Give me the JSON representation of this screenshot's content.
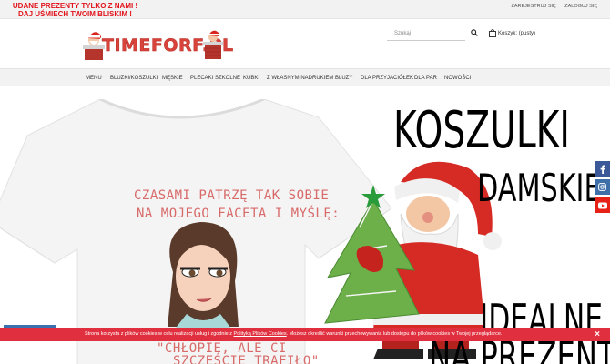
{
  "topbar": {
    "promo_line1": "UDANE PREZENTY TYLKO Z NAMI !",
    "promo_line2": "DAJ UŚMIECH TWOIM BLISKIM !",
    "register": "ZAREJESTRUJ SIĘ",
    "login": "ZALOGUJ SIĘ"
  },
  "header": {
    "logo_text": "TIMEFORF.PL",
    "search_placeholder": "Szukaj",
    "cart_label": "Koszyk: (pusty)"
  },
  "nav": {
    "items": [
      "MENU",
      "BLUZKI/KOSZULKI",
      "MĘSKIE",
      "PLECAKI SZKOLNE",
      "KUBKI",
      "Z WŁASNYM NADRUKIEM",
      "BLUZY",
      "DLA PRZYJACIÓŁEK",
      "DLA PAR",
      "NOWOŚCI"
    ]
  },
  "banner": {
    "shirt_line1": "CZASAMI PATRZĘ TAK SOBIE",
    "shirt_line2": "NA MOJEGO FACETA I MYŚLĘ:",
    "shirt_line3": "\"CHŁOPIE, ALE CI",
    "shirt_line4": "SZCZĘŚCIE TRAFIŁO\"",
    "heading1": "KOSZULKI",
    "heading2": "DAMSKIE",
    "heading3": "IDEALNE",
    "heading4": "NA PREZENT"
  },
  "cookie": {
    "text_before": "Strona korzysta z plików cookies w celu realizacji usług i zgodnie z ",
    "link": "Polityką Plików Cookies",
    "text_after": ". Możesz określić warunki przechowywania lub dostępu do plików cookies w Twojej przeglądarce.",
    "close": "×"
  },
  "colors": {
    "promo_red": "#e2141c",
    "cookie_red": "#e0303f",
    "facebook": "#3b5998",
    "instagram": "#3f6fa8",
    "youtube": "#e62117"
  },
  "social": [
    "facebook-icon",
    "instagram-icon",
    "youtube-icon"
  ]
}
